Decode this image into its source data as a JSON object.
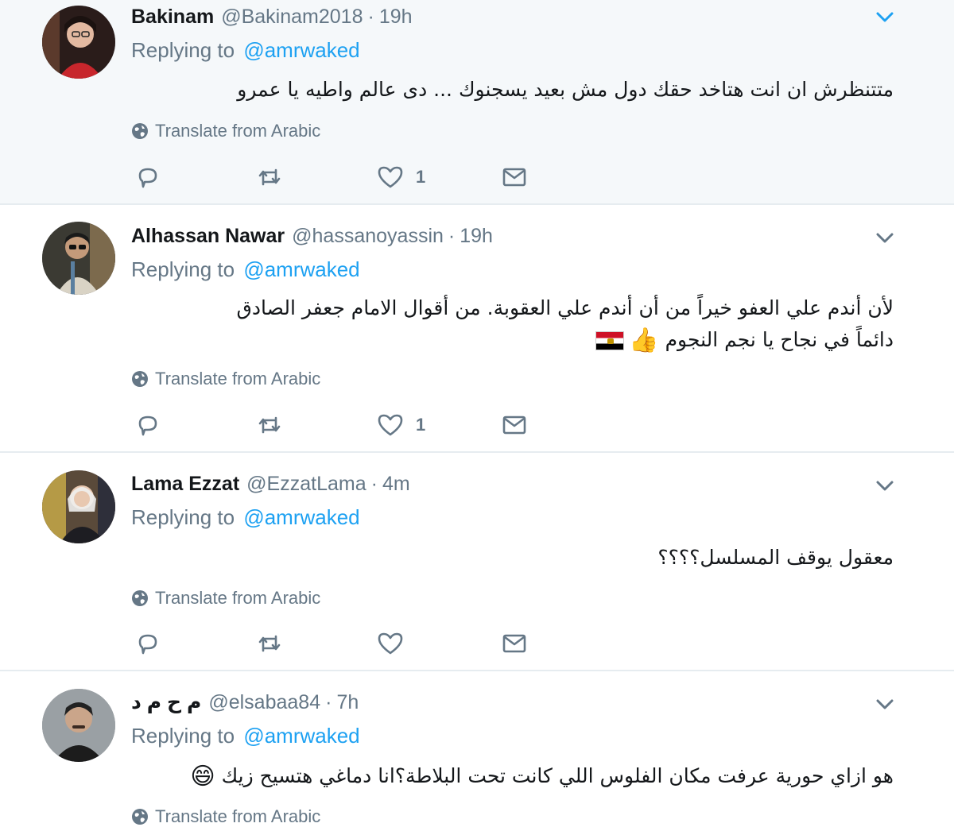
{
  "tweets": [
    {
      "name": "Bakinam",
      "handle": "@Bakinam2018",
      "time": "19h",
      "replying_label": "Replying to",
      "replying_to": "@amrwaked",
      "lines": [
        "متتنظرش ان انت هتاخد حقك دول مش بعيد يسجنوك ... دى عالم واطيه يا عمرو"
      ],
      "translate": "Translate from Arabic",
      "likes": "1"
    },
    {
      "name": "Alhassan Nawar",
      "handle": "@hassanoyassin",
      "time": "19h",
      "replying_label": "Replying to",
      "replying_to": "@amrwaked",
      "lines": [
        "لأن أندم علي العفو خيراً من أن أندم علي العقوبة. من أقوال الامام جعفر الصادق",
        "دائماً في نجاح يا نجم النجوم"
      ],
      "line2_emoji": "👍",
      "translate": "Translate from Arabic",
      "likes": "1"
    },
    {
      "name": "Lama Ezzat",
      "handle": "@EzzatLama",
      "time": "4m",
      "replying_label": "Replying to",
      "replying_to": "@amrwaked",
      "lines": [
        "معقول يوقف المسلسل؟؟؟؟"
      ],
      "translate": "Translate from Arabic",
      "likes": ""
    },
    {
      "name": "م ح م د",
      "handle": "@elsabaa84",
      "time": "7h",
      "replying_label": "Replying to",
      "replying_to": "@amrwaked",
      "lines": [
        "هو ازاي حورية عرفت مكان الفلوس اللي كانت تحت البلاطة؟انا دماغي هتسيح زيك"
      ],
      "line1_emoji": "😄",
      "translate": "Translate from Arabic",
      "likes": ""
    }
  ],
  "icons": {
    "reply": "reply-icon",
    "retweet": "retweet-icon",
    "like": "heart-icon",
    "dm": "envelope-icon",
    "caret": "chevron-down-icon",
    "globe": "globe-icon"
  },
  "colors": {
    "link": "#1da1f2",
    "muted": "#657786",
    "highlight_bg": "#f5f8fa",
    "border": "#e6ecf0"
  }
}
